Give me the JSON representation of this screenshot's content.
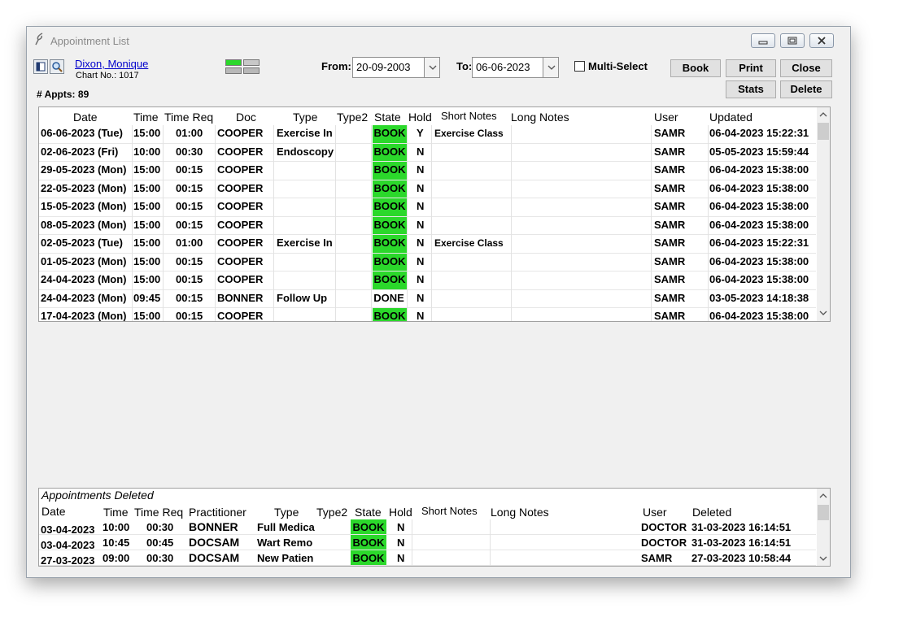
{
  "window": {
    "title": "Appointment List"
  },
  "patient": {
    "name": "Dixon, Monique",
    "chart_no": "Chart No.: 1017"
  },
  "summary": {
    "appt_count": "# Appts: 89"
  },
  "filters": {
    "from_label": "From:",
    "from_value": "20-09-2003",
    "to_label": "To:",
    "to_value": "06-06-2023",
    "multi_select_label": "Multi-Select"
  },
  "buttons": {
    "book": "Book",
    "print": "Print",
    "close": "Close",
    "stats": "Stats",
    "delete": "Delete"
  },
  "colors": {
    "book_state": "#2bd82b",
    "link": "#0000cc"
  },
  "appointments": {
    "columns": {
      "date": "Date",
      "time": "Time",
      "time_req": "Time Req",
      "doc": "Doc",
      "type": "Type",
      "type2": "Type2",
      "state": "State",
      "hold": "Hold",
      "short_notes": "Short Notes",
      "long_notes": "Long Notes",
      "user": "User",
      "updated": "Updated"
    },
    "rows": [
      {
        "date": "06-06-2023 (Tue)",
        "time": "15:00",
        "time_req": "01:00",
        "doc": "COOPER",
        "type": "Exercise In",
        "type2": "",
        "state": "BOOK",
        "hold": "Y",
        "short_notes": "Exercise Class",
        "long_notes": "",
        "user": "SAMR",
        "updated": "06-04-2023 15:22:31"
      },
      {
        "date": "02-06-2023 (Fri)",
        "time": "10:00",
        "time_req": "00:30",
        "doc": "COOPER",
        "type": "Endoscopy",
        "type2": "",
        "state": "BOOK",
        "hold": "N",
        "short_notes": "",
        "long_notes": "",
        "user": "SAMR",
        "updated": "05-05-2023 15:59:44"
      },
      {
        "date": "29-05-2023 (Mon)",
        "time": "15:00",
        "time_req": "00:15",
        "doc": "COOPER",
        "type": "",
        "type2": "",
        "state": "BOOK",
        "hold": "N",
        "short_notes": "",
        "long_notes": "",
        "user": "SAMR",
        "updated": "06-04-2023 15:38:00"
      },
      {
        "date": "22-05-2023 (Mon)",
        "time": "15:00",
        "time_req": "00:15",
        "doc": "COOPER",
        "type": "",
        "type2": "",
        "state": "BOOK",
        "hold": "N",
        "short_notes": "",
        "long_notes": "",
        "user": "SAMR",
        "updated": "06-04-2023 15:38:00"
      },
      {
        "date": "15-05-2023 (Mon)",
        "time": "15:00",
        "time_req": "00:15",
        "doc": "COOPER",
        "type": "",
        "type2": "",
        "state": "BOOK",
        "hold": "N",
        "short_notes": "",
        "long_notes": "",
        "user": "SAMR",
        "updated": "06-04-2023 15:38:00"
      },
      {
        "date": "08-05-2023 (Mon)",
        "time": "15:00",
        "time_req": "00:15",
        "doc": "COOPER",
        "type": "",
        "type2": "",
        "state": "BOOK",
        "hold": "N",
        "short_notes": "",
        "long_notes": "",
        "user": "SAMR",
        "updated": "06-04-2023 15:38:00"
      },
      {
        "date": "02-05-2023 (Tue)",
        "time": "15:00",
        "time_req": "01:00",
        "doc": "COOPER",
        "type": "Exercise In",
        "type2": "",
        "state": "BOOK",
        "hold": "N",
        "short_notes": "Exercise Class",
        "long_notes": "",
        "user": "SAMR",
        "updated": "06-04-2023 15:22:31"
      },
      {
        "date": "01-05-2023 (Mon)",
        "time": "15:00",
        "time_req": "00:15",
        "doc": "COOPER",
        "type": "",
        "type2": "",
        "state": "BOOK",
        "hold": "N",
        "short_notes": "",
        "long_notes": "",
        "user": "SAMR",
        "updated": "06-04-2023 15:38:00"
      },
      {
        "date": "24-04-2023 (Mon)",
        "time": "15:00",
        "time_req": "00:15",
        "doc": "COOPER",
        "type": "",
        "type2": "",
        "state": "BOOK",
        "hold": "N",
        "short_notes": "",
        "long_notes": "",
        "user": "SAMR",
        "updated": "06-04-2023 15:38:00"
      },
      {
        "date": "24-04-2023 (Mon)",
        "time": "09:45",
        "time_req": "00:15",
        "doc": "BONNER",
        "type": "Follow Up",
        "type2": "",
        "state": "DONE",
        "hold": "N",
        "short_notes": "",
        "long_notes": "",
        "user": "SAMR",
        "updated": "03-05-2023 14:18:38"
      },
      {
        "date": "17-04-2023 (Mon)",
        "time": "15:00",
        "time_req": "00:15",
        "doc": "COOPER",
        "type": "",
        "type2": "",
        "state": "BOOK",
        "hold": "N",
        "short_notes": "",
        "long_notes": "",
        "user": "SAMR",
        "updated": "06-04-2023 15:38:00"
      }
    ]
  },
  "deleted": {
    "title": "Appointments Deleted",
    "columns": {
      "date": "Date",
      "time": "Time",
      "time_req": "Time Req",
      "practitioner": "Practitioner",
      "type": "Type",
      "type2": "Type2",
      "state": "State",
      "hold": "Hold",
      "short_notes": "Short Notes",
      "long_notes": "Long Notes",
      "user": "User",
      "deleted": "Deleted"
    },
    "rows": [
      {
        "date": "03-04-2023",
        "time": "10:00",
        "time_req": "00:30",
        "practitioner": "BONNER",
        "type": "Full Medica",
        "type2": "",
        "state": "BOOK",
        "hold": "N",
        "short_notes": "",
        "long_notes": "",
        "user": "DOCTOR",
        "deleted": "31-03-2023 16:14:51"
      },
      {
        "date": "03-04-2023",
        "time": "10:45",
        "time_req": "00:45",
        "practitioner": "DOCSAM",
        "type": "Wart Remo",
        "type2": "",
        "state": "BOOK",
        "hold": "N",
        "short_notes": "",
        "long_notes": "",
        "user": "DOCTOR",
        "deleted": "31-03-2023 16:14:51"
      },
      {
        "date": "27-03-2023",
        "time": "09:00",
        "time_req": "00:30",
        "practitioner": "DOCSAM",
        "type": "New Patien",
        "type2": "",
        "state": "BOOK",
        "hold": "N",
        "short_notes": "",
        "long_notes": "",
        "user": "SAMR",
        "deleted": "27-03-2023 10:58:44"
      }
    ]
  }
}
